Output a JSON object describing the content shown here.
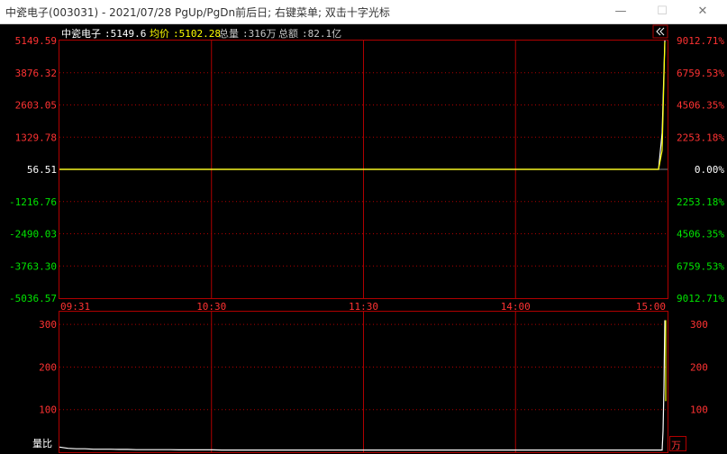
{
  "window": {
    "title": "中瓷电子(003031) - 2021/07/28 PgUp/PgDn前后日; 右键菜单; 双击十字光标",
    "minimize_icon": "minimize-icon",
    "maximize_icon": "maximize-icon",
    "close_icon": "close-icon"
  },
  "info_bar": {
    "name": "中瓷电子",
    "price": ":5149.6",
    "avg_label": "均价",
    "avg_value": ":5102.28",
    "volume_label": "总量",
    "volume_value": ":316万",
    "amount_label": "总额",
    "amount_value": ":82.1亿",
    "collapse_icon": "double-chevron-left-icon"
  },
  "colors": {
    "up": "#ff3232",
    "down": "#00e600",
    "price_line": "#ffffff",
    "avg_line": "#ffff00",
    "grid": "#b00000"
  },
  "chart_data": [
    {
      "type": "line",
      "title": "",
      "x_ticks": [
        "09:31",
        "10:30",
        "11:30",
        "14:00",
        "15:00"
      ],
      "y_left_ticks": [
        "5149.59",
        "3876.32",
        "2603.05",
        "1329.78",
        "56.51",
        "-1216.76",
        "-2490.03",
        "-3763.30",
        "-5036.57"
      ],
      "y_right_ticks": [
        "9012.71%",
        "6759.53%",
        "4506.35%",
        "2253.18%",
        "0.00%",
        "2253.18%",
        "4506.35%",
        "6759.53%",
        "9012.71%"
      ],
      "ylim": [
        -5036.57,
        5149.59
      ],
      "base_price": 56.51,
      "grid": true,
      "series": [
        {
          "values": [
            56.51,
            56.6,
            56.4,
            56.5,
            56.7,
            56.5,
            56.6,
            56.5,
            56.5,
            56.6,
            56.5,
            56.5,
            56.6,
            56.5,
            56.5,
            56.5,
            56.5,
            56.5,
            56.5,
            56.5,
            56.5,
            56.5,
            56.5,
            56.5,
            56.5,
            56.5,
            56.5,
            56.5,
            56.5,
            56.5,
            56.5,
            1500,
            5149.6
          ]
        },
        {
          "values": [
            56.51,
            56.55,
            56.5,
            56.52,
            56.55,
            56.52,
            56.53,
            56.52,
            56.52,
            56.53,
            56.52,
            56.52,
            56.53,
            56.52,
            56.52,
            56.52,
            56.52,
            56.52,
            56.52,
            56.52,
            56.52,
            56.52,
            56.52,
            56.52,
            56.52,
            56.52,
            56.52,
            56.52,
            56.52,
            56.52,
            56.52,
            800,
            5102.28
          ]
        }
      ]
    },
    {
      "type": "line",
      "title": "量比",
      "unit": "万",
      "y_left_ticks": [
        "300",
        "200",
        "100"
      ],
      "y_right_ticks": [
        "300",
        "200",
        "100"
      ],
      "ylim": [
        0,
        330
      ],
      "series": [
        {
          "values": [
            12,
            9,
            8,
            8,
            7,
            7,
            7,
            6.5,
            6.5,
            6,
            6,
            6,
            6,
            6,
            5.5,
            5.5,
            5.5,
            5.5,
            5.5,
            5,
            5,
            5,
            5,
            5,
            5,
            5,
            5,
            5,
            5,
            5,
            5,
            50,
            150,
            310
          ]
        }
      ]
    }
  ]
}
